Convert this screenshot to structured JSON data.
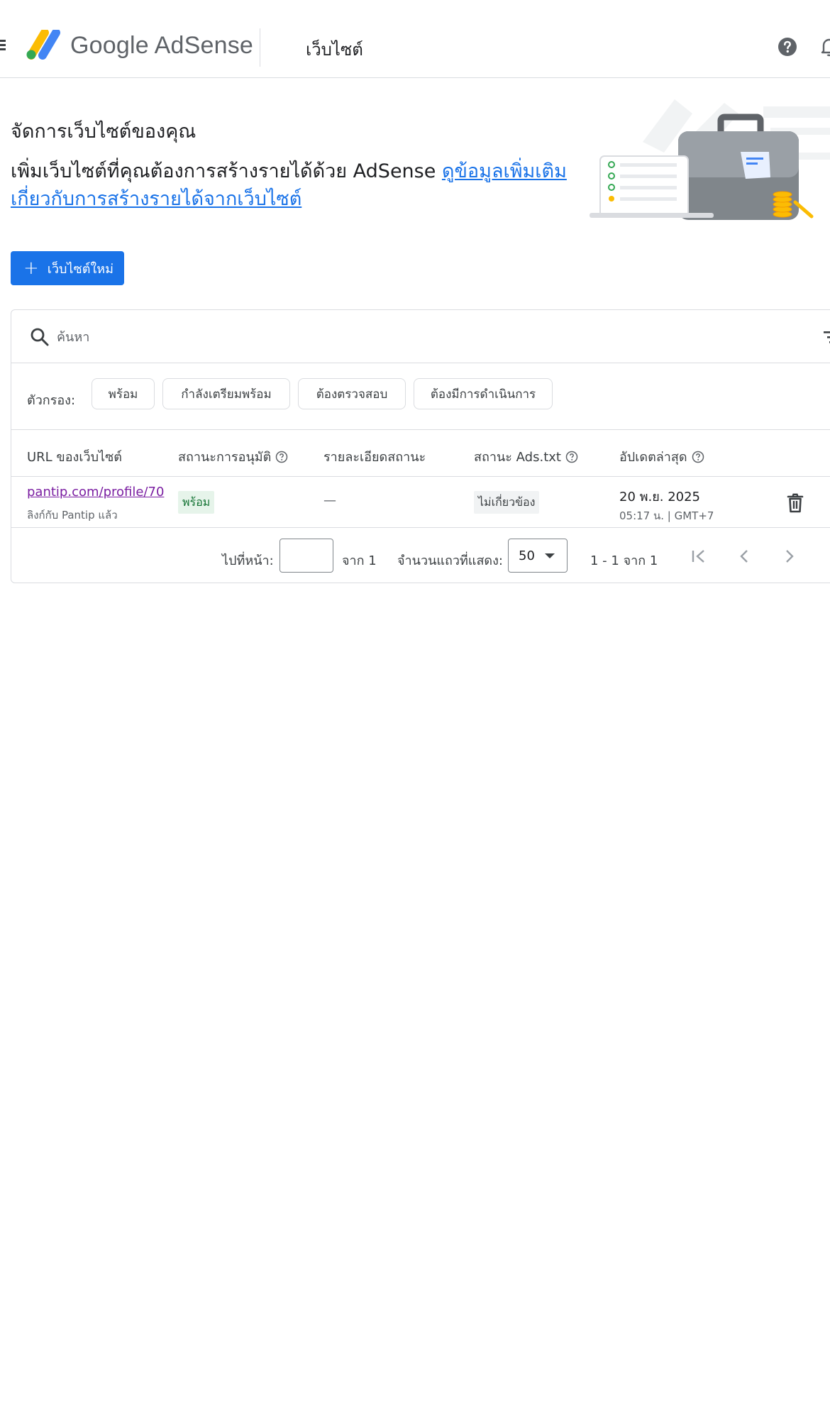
{
  "header": {
    "app_name": "Google AdSense",
    "section_title": "เว็บไซต์"
  },
  "intro": {
    "title": "จัดการเว็บไซต์ของคุณ",
    "description": "เพิ่มเว็บไซต์ที่คุณต้องการสร้างรายได้ด้วย AdSense",
    "learn_more_link": "ดูข้อมูลเพิ่มเติมเกี่ยวกับการสร้างรายได้จากเว็บไซต์"
  },
  "new_site_button": {
    "label": "เว็บไซต์ใหม่"
  },
  "search": {
    "placeholder": "ค้นหา"
  },
  "filters": {
    "label": "ตัวกรอง:",
    "chips": [
      "พร้อม",
      "กำลังเตรียมพร้อม",
      "ต้องตรวจสอบ",
      "ต้องมีการดำเนินการ"
    ]
  },
  "table": {
    "columns": [
      "URL ของเว็บไซต์",
      "สถานะการอนุมัติ",
      "รายละเอียดสถานะ",
      "สถานะ Ads.txt",
      "อัปเดตล่าสุด"
    ],
    "rows": [
      {
        "url": "pantip.com/profile/70",
        "sub": "ลิงก์กับ Pantip แล้ว",
        "approval_status": "พร้อม",
        "status_detail": "—",
        "ads_txt_status": "ไม่เกี่ยวข้อง",
        "updated_date": "20 พ.ย. 2025",
        "updated_time": "05:17 น. | GMT+7"
      }
    ]
  },
  "pagination": {
    "go_to_page_label": "ไปที่หน้า:",
    "page_input_value": "",
    "of_pages": "จาก 1",
    "rows_label": "จำนวนแถวที่แสดง:",
    "rows_value": "50",
    "range": "1 - 1 จาก 1"
  },
  "colors": {
    "primary": "#1a73e8",
    "visited_link": "#7b1fa2",
    "ready_bg": "#e6f4ea",
    "ready_text": "#137333"
  }
}
